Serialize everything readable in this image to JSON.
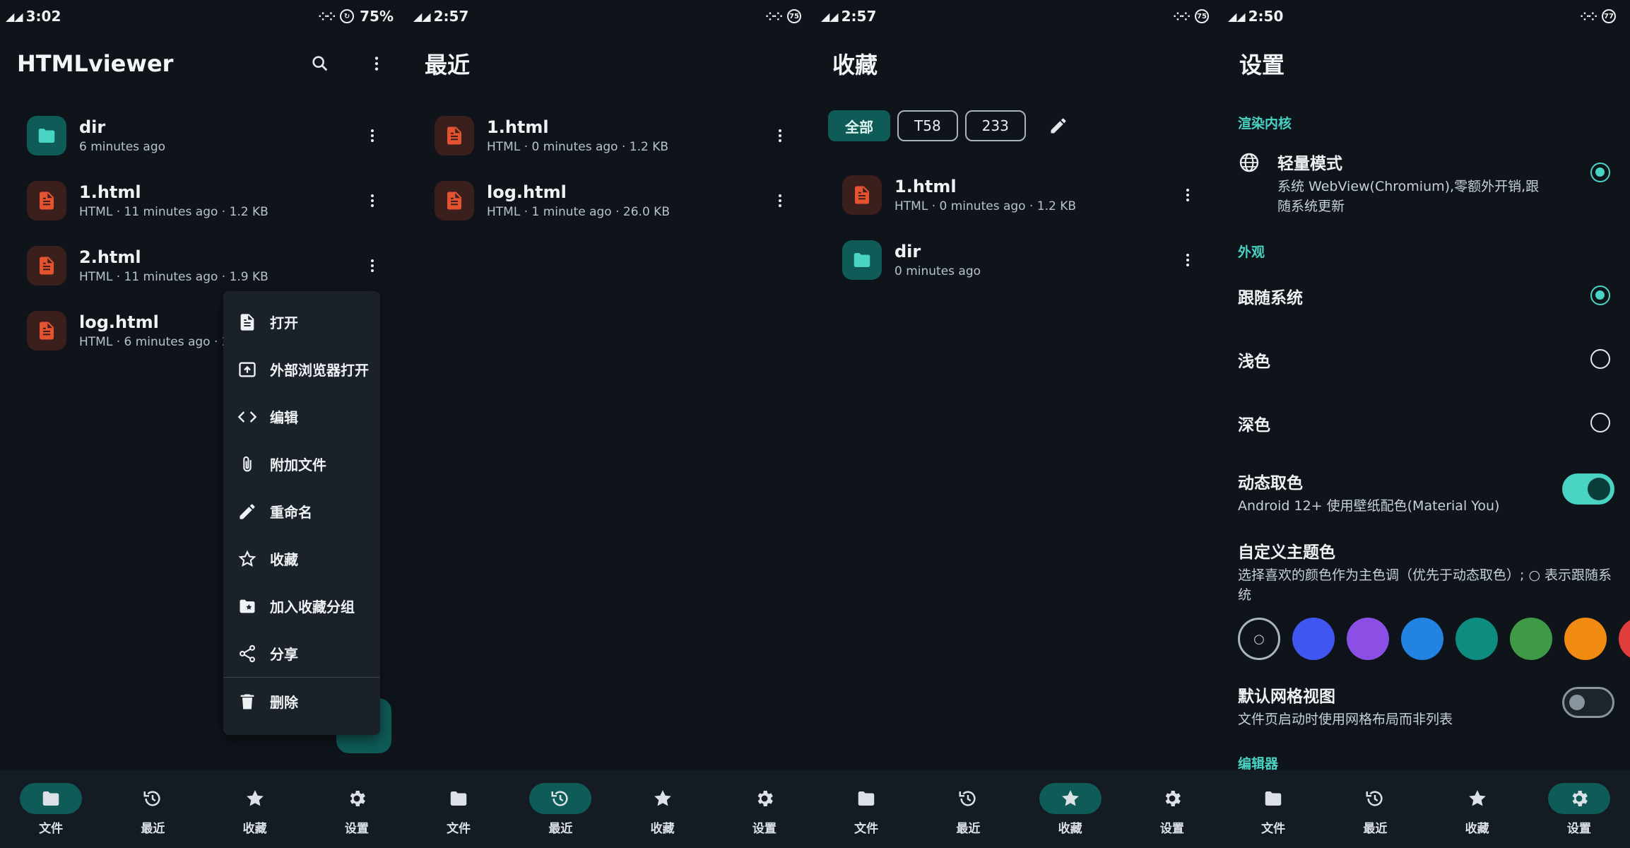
{
  "status_bars": [
    {
      "time": "3:02",
      "battery": "75%"
    },
    {
      "time": "2:57",
      "battery": "75"
    },
    {
      "time": "2:57",
      "battery": "75"
    },
    {
      "time": "2:50",
      "battery": "77"
    }
  ],
  "files_screen": {
    "title": "HTMLviewer",
    "items": [
      {
        "name": "dir",
        "meta": "6 minutes ago",
        "type": "folder"
      },
      {
        "name": "1.html",
        "meta": "HTML · 11 minutes ago · 1.2 KB",
        "type": "doc"
      },
      {
        "name": "2.html",
        "meta": "HTML · 11 minutes ago · 1.9 KB",
        "type": "doc"
      },
      {
        "name": "log.html",
        "meta": "HTML · 6 minutes ago · 2",
        "type": "doc"
      }
    ],
    "menu": [
      "打开",
      "外部浏览器打开",
      "编辑",
      "附加文件",
      "重命名",
      "收藏",
      "加入收藏分组",
      "分享",
      "删除"
    ]
  },
  "recent_screen": {
    "title": "最近",
    "items": [
      {
        "name": "1.html",
        "meta": "HTML · 0 minutes ago · 1.2 KB"
      },
      {
        "name": "log.html",
        "meta": "HTML · 1 minute ago · 26.0 KB"
      }
    ]
  },
  "favorites_screen": {
    "title": "收藏",
    "chips": [
      "全部",
      "T58",
      "233"
    ],
    "items": [
      {
        "name": "1.html",
        "meta": "HTML · 0 minutes ago · 1.2 KB"
      },
      {
        "name": "dir",
        "meta": "0 minutes ago"
      }
    ]
  },
  "settings_screen": {
    "title": "设置",
    "section_render": "渲染内核",
    "light_mode_title": "轻量模式",
    "light_mode_desc": "系统 WebView(Chromium),零额外开销,跟随系统更新",
    "section_appearance": "外观",
    "theme_follow": "跟随系统",
    "theme_light": "浅色",
    "theme_dark": "深色",
    "dynamic_title": "动态取色",
    "dynamic_desc": "Android 12+ 使用壁纸配色(Material You)",
    "custom_title": "自定义主题色",
    "custom_desc": "选择喜欢的颜色作为主色调（优先于动态取色）; ○ 表示跟随系统",
    "swatch_empty_symbol": "○",
    "swatches": [
      "#3f57f0",
      "#8c4fe6",
      "#2383e2",
      "#0e8c80",
      "#3f9a45",
      "#f08a11",
      "#e03c3c"
    ],
    "grid_title": "默认网格视图",
    "grid_desc": "文件页启动时使用网格布局而非列表",
    "section_editor": "编辑器"
  },
  "nav": {
    "files": "文件",
    "recent": "最近",
    "favorites": "收藏",
    "settings": "设置"
  },
  "colors": {
    "accent": "#49d3c2",
    "accent_container": "#0f5b57",
    "doc_icon": "#e4532f",
    "background": "#0f141b"
  }
}
